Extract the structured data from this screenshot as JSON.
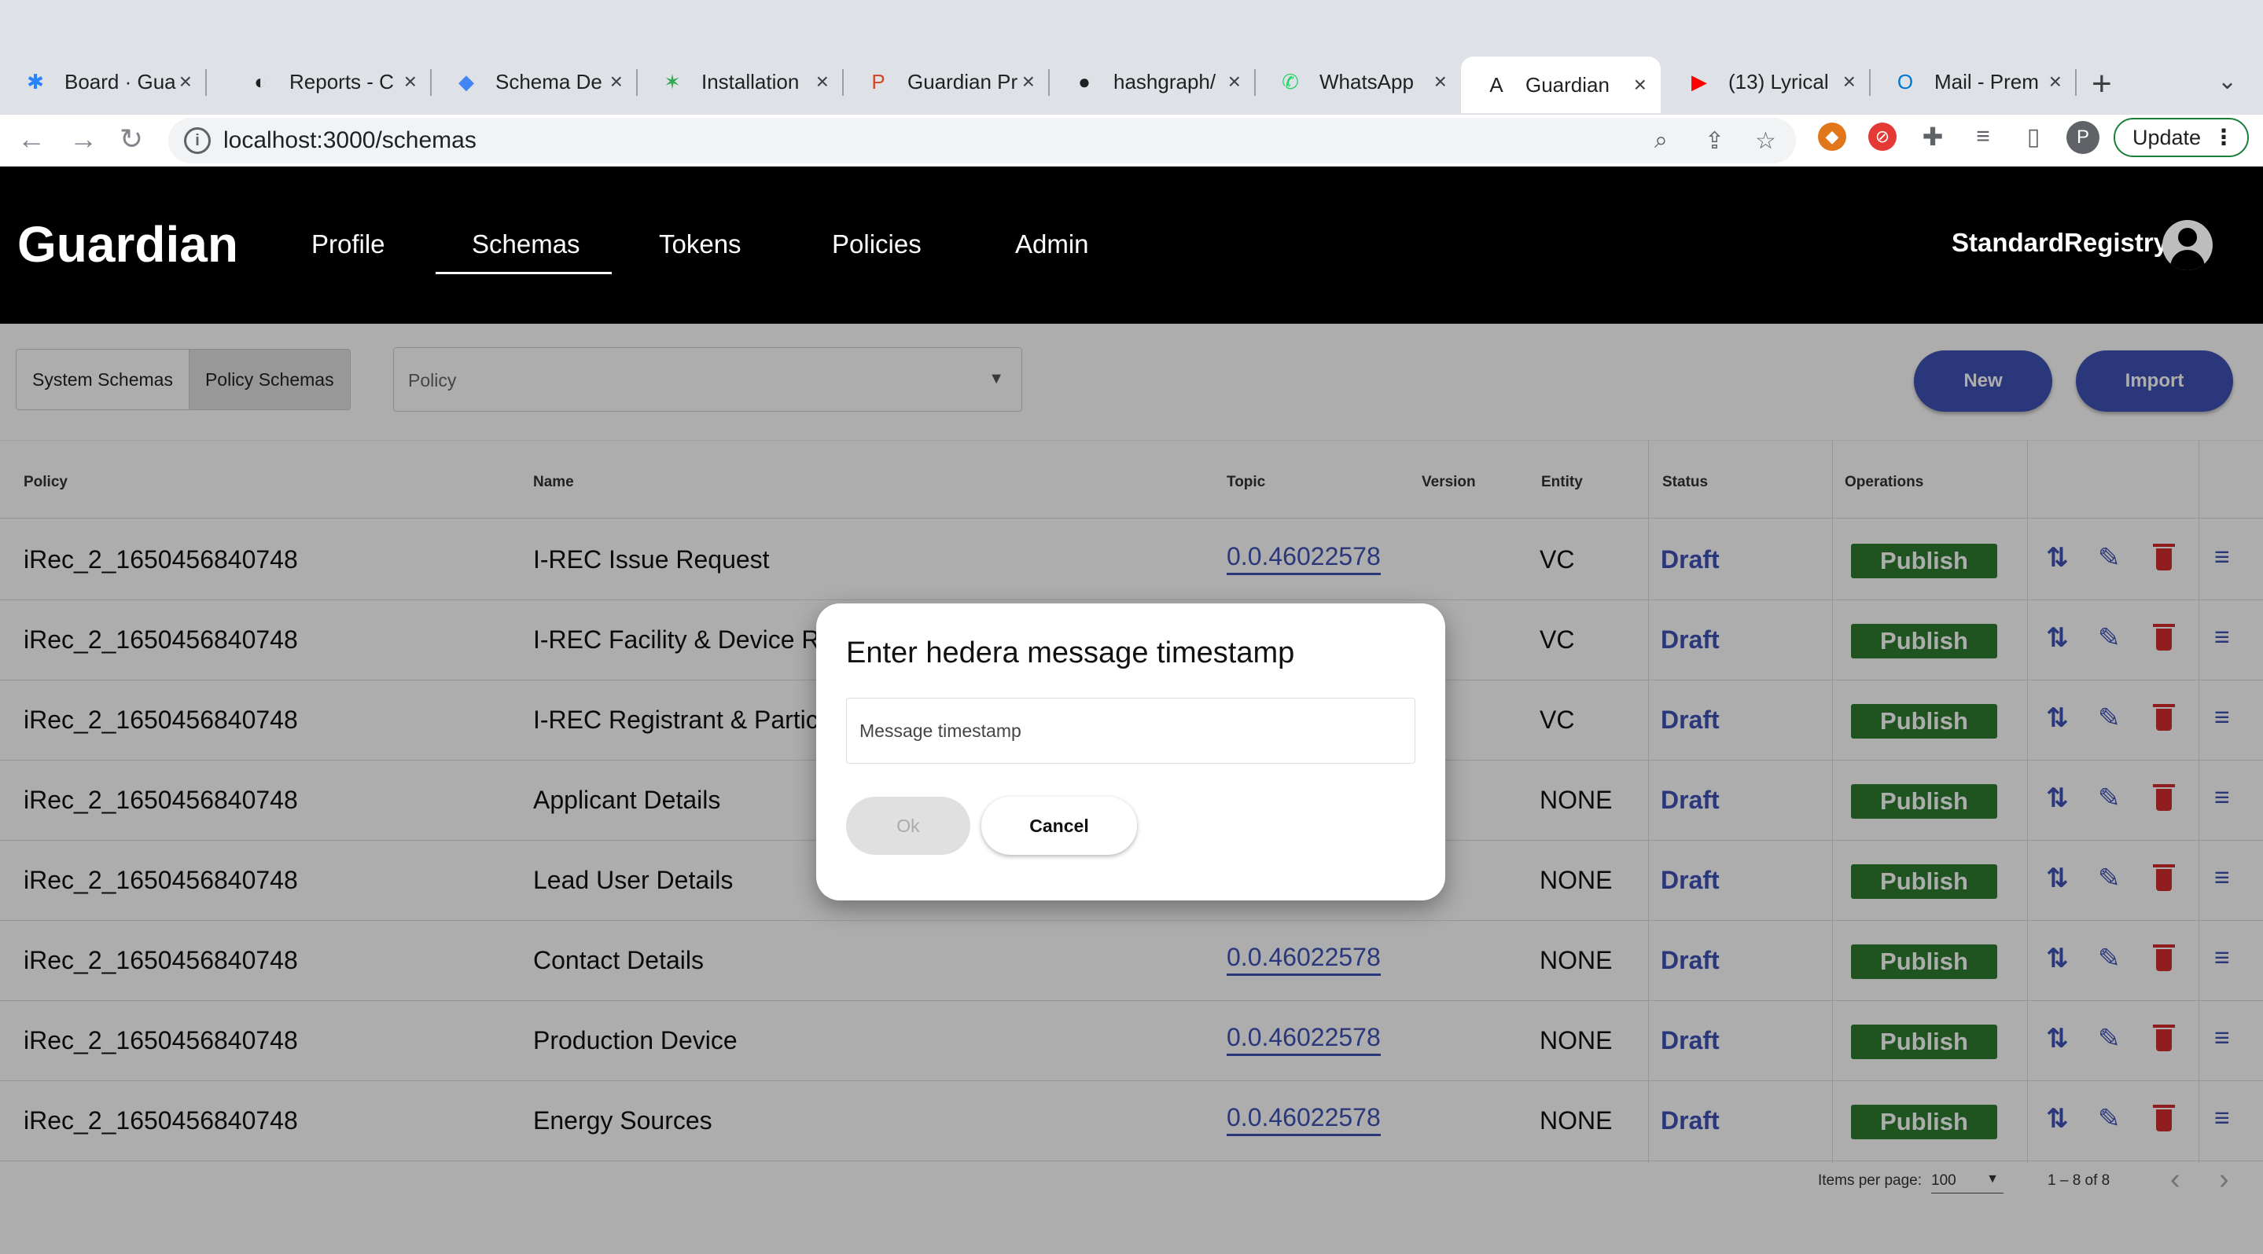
{
  "browser": {
    "tabs": [
      {
        "label": "Board · Gua",
        "icon": "jira-icon",
        "color": "#2684ff",
        "glyph": "✱"
      },
      {
        "label": "Reports - C",
        "icon": "reports-icon",
        "color": "#202124",
        "glyph": "◐"
      },
      {
        "label": "Schema De",
        "icon": "layers-icon",
        "color": "#4285f4",
        "glyph": "◆"
      },
      {
        "label": "Installation",
        "icon": "palm-icon",
        "color": "#34a853",
        "glyph": "✶"
      },
      {
        "label": "Guardian Pr",
        "icon": "powerpoint-icon",
        "color": "#d24726",
        "glyph": "P"
      },
      {
        "label": "hashgraph/",
        "icon": "github-icon",
        "color": "#202124",
        "glyph": "●"
      },
      {
        "label": "WhatsApp",
        "icon": "whatsapp-icon",
        "color": "#25d366",
        "glyph": "✆"
      },
      {
        "label": "Guardian",
        "icon": "angular-icon",
        "color": "#202124",
        "glyph": "A"
      },
      {
        "label": "(13) Lyrical",
        "icon": "youtube-icon",
        "color": "#ff0000",
        "glyph": "▶"
      },
      {
        "label": "Mail - Prem",
        "icon": "outlook-icon",
        "color": "#0078d4",
        "glyph": "O"
      }
    ],
    "active_tab": 7,
    "url": "localhost:3000/schemas",
    "update_label": "Update",
    "profile_initial": "P"
  },
  "app": {
    "logo": "Guardian",
    "nav": [
      "Profile",
      "Schemas",
      "Tokens",
      "Policies",
      "Admin"
    ],
    "active_nav": "Schemas",
    "user": "StandardRegistry"
  },
  "toolbar": {
    "system_schemas": "System Schemas",
    "policy_schemas": "Policy Schemas",
    "policy_label": "Policy",
    "new_label": "New",
    "import_label": "Import"
  },
  "table": {
    "headers": {
      "policy": "Policy",
      "name": "Name",
      "topic": "Topic",
      "version": "Version",
      "entity": "Entity",
      "status": "Status",
      "operations": "Operations"
    },
    "publish_label": "Publish",
    "rows": [
      {
        "policy": "iRec_2_1650456840748",
        "name": "I-REC Issue Request",
        "topic": "0.0.46022578",
        "entity": "VC",
        "status": "Draft"
      },
      {
        "policy": "iRec_2_1650456840748",
        "name": "I-REC Facility & Device Re",
        "topic": "",
        "entity": "VC",
        "status": "Draft"
      },
      {
        "policy": "iRec_2_1650456840748",
        "name": "I-REC Registrant & Partici",
        "topic": "",
        "entity": "VC",
        "status": "Draft"
      },
      {
        "policy": "iRec_2_1650456840748",
        "name": "Applicant Details",
        "topic": "",
        "entity": "NONE",
        "status": "Draft"
      },
      {
        "policy": "iRec_2_1650456840748",
        "name": "Lead User Details",
        "topic": "",
        "entity": "NONE",
        "status": "Draft"
      },
      {
        "policy": "iRec_2_1650456840748",
        "name": "Contact Details",
        "topic": "0.0.46022578",
        "entity": "NONE",
        "status": "Draft"
      },
      {
        "policy": "iRec_2_1650456840748",
        "name": "Production Device",
        "topic": "0.0.46022578",
        "entity": "NONE",
        "status": "Draft"
      },
      {
        "policy": "iRec_2_1650456840748",
        "name": "Energy Sources",
        "topic": "0.0.46022578",
        "entity": "NONE",
        "status": "Draft"
      }
    ]
  },
  "paginator": {
    "items_per_page_label": "Items per page:",
    "items_per_page": "100",
    "range": "1 – 8 of 8"
  },
  "dialog": {
    "title": "Enter hedera message timestamp",
    "placeholder": "Message timestamp",
    "ok": "Ok",
    "cancel": "Cancel"
  }
}
